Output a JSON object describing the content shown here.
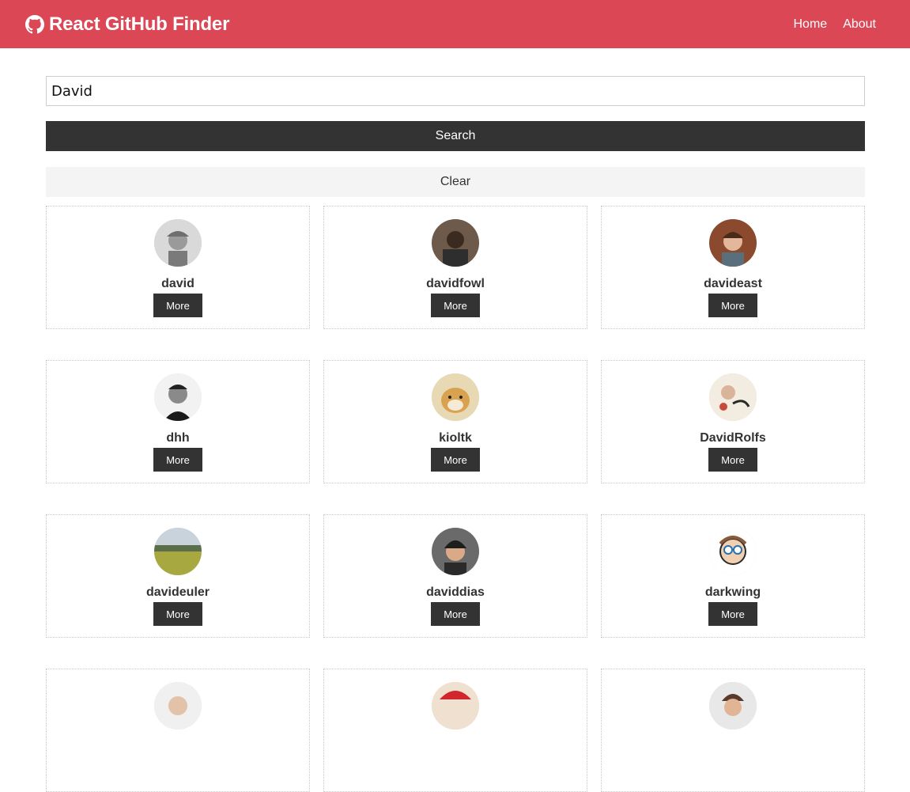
{
  "app": {
    "title": "React GitHub Finder",
    "icon": "github-icon"
  },
  "nav": {
    "links": [
      {
        "label": "Home"
      },
      {
        "label": "About"
      }
    ]
  },
  "search": {
    "value": "David",
    "search_label": "Search",
    "clear_label": "Clear"
  },
  "users": [
    {
      "login": "david",
      "more_label": "More",
      "avatar_hint": "grey portrait with cap"
    },
    {
      "login": "davidfowl",
      "more_label": "More",
      "avatar_hint": "dark portrait"
    },
    {
      "login": "davideast",
      "more_label": "More",
      "avatar_hint": "portrait on brown background"
    },
    {
      "login": "dhh",
      "more_label": "More",
      "avatar_hint": "black and white portrait"
    },
    {
      "login": "kioltk",
      "more_label": "More",
      "avatar_hint": "shiba dog"
    },
    {
      "login": "DavidRolfs",
      "more_label": "More",
      "avatar_hint": "watercolor illustration"
    },
    {
      "login": "davideuler",
      "more_label": "More",
      "avatar_hint": "green field landscape"
    },
    {
      "login": "daviddias",
      "more_label": "More",
      "avatar_hint": "smiling portrait"
    },
    {
      "login": "darkwing",
      "more_label": "More",
      "avatar_hint": "cartoon character"
    },
    {
      "login": "",
      "more_label": "",
      "avatar_hint": "partially visible portrait"
    },
    {
      "login": "",
      "more_label": "",
      "avatar_hint": "partially visible red cap"
    },
    {
      "login": "",
      "more_label": "",
      "avatar_hint": "partially visible portrait"
    }
  ],
  "colors": {
    "navbar": "#dc4756",
    "dark": "#333333",
    "light": "#f4f4f4"
  }
}
